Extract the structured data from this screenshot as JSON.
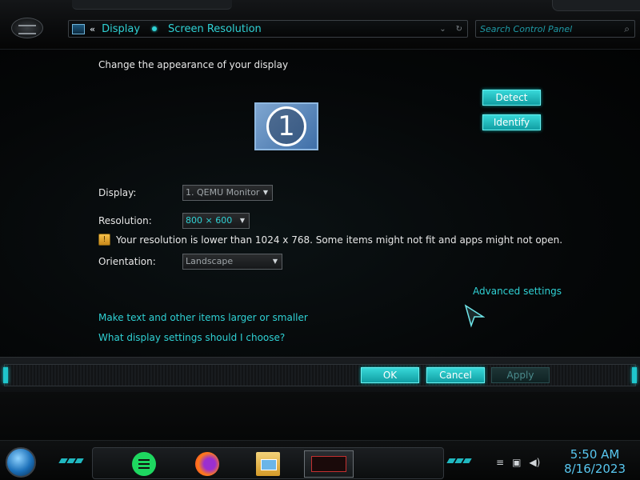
{
  "addressbar": {
    "back_label": "«",
    "crumbs": [
      "Display",
      "Screen Resolution"
    ],
    "dropdown_glyph": "⌄",
    "refresh_glyph": "↻"
  },
  "search": {
    "placeholder": "Search Control Panel",
    "icon": "search-icon"
  },
  "content": {
    "heading": "Change the appearance of your display",
    "monitor_number": "1",
    "detect_label": "Detect",
    "identify_label": "Identify",
    "display_label": "Display:",
    "display_value": "1. QEMU Monitor",
    "resolution_label": "Resolution:",
    "resolution_value": "800 × 600",
    "warning_text": "Your resolution is lower than 1024 x 768. Some items might not fit and apps might not open.",
    "orientation_label": "Orientation:",
    "orientation_value": "Landscape",
    "advanced_link": "Advanced settings",
    "link_text_size": "Make text and other items larger or smaller",
    "link_settings_help": "What display settings should I choose?"
  },
  "buttons": {
    "ok": "OK",
    "cancel": "Cancel",
    "apply": "Apply"
  },
  "taskbar": {
    "apps": [
      "spotify-icon",
      "firefox-icon",
      "file-explorer-icon",
      "active-window-thumbnail"
    ],
    "time": "5:50 AM",
    "date": "8/16/2023"
  },
  "colors": {
    "accent": "#2fd1d4",
    "button": "#1fbfc4",
    "clock": "#58c7f0"
  }
}
